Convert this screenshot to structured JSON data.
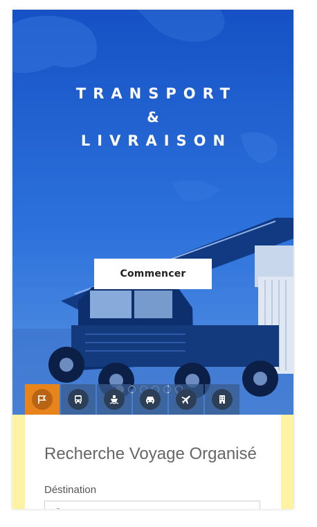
{
  "hero": {
    "line1": "TRANSPORT",
    "ampersand": "&",
    "line2": "LIVRAISON",
    "cta_label": "Commencer",
    "slide_count": 6,
    "active_slide": 1
  },
  "tabs": [
    {
      "icon": "flag-icon",
      "active": true
    },
    {
      "icon": "bus-icon",
      "active": false
    },
    {
      "icon": "ship-icon",
      "active": false
    },
    {
      "icon": "car-icon",
      "active": false
    },
    {
      "icon": "plane-icon",
      "active": false
    },
    {
      "icon": "hotel-icon",
      "active": false
    }
  ],
  "search": {
    "title": "Recherche Voyage Organisé",
    "destination_label": "Déstination",
    "destination_placeholder": "Pays/Wilaya",
    "destination_value": ""
  },
  "colors": {
    "hero_blue": "#1c5fc9",
    "tab_active": "#e8841c",
    "panel_backdrop": "#fdf3a3"
  }
}
